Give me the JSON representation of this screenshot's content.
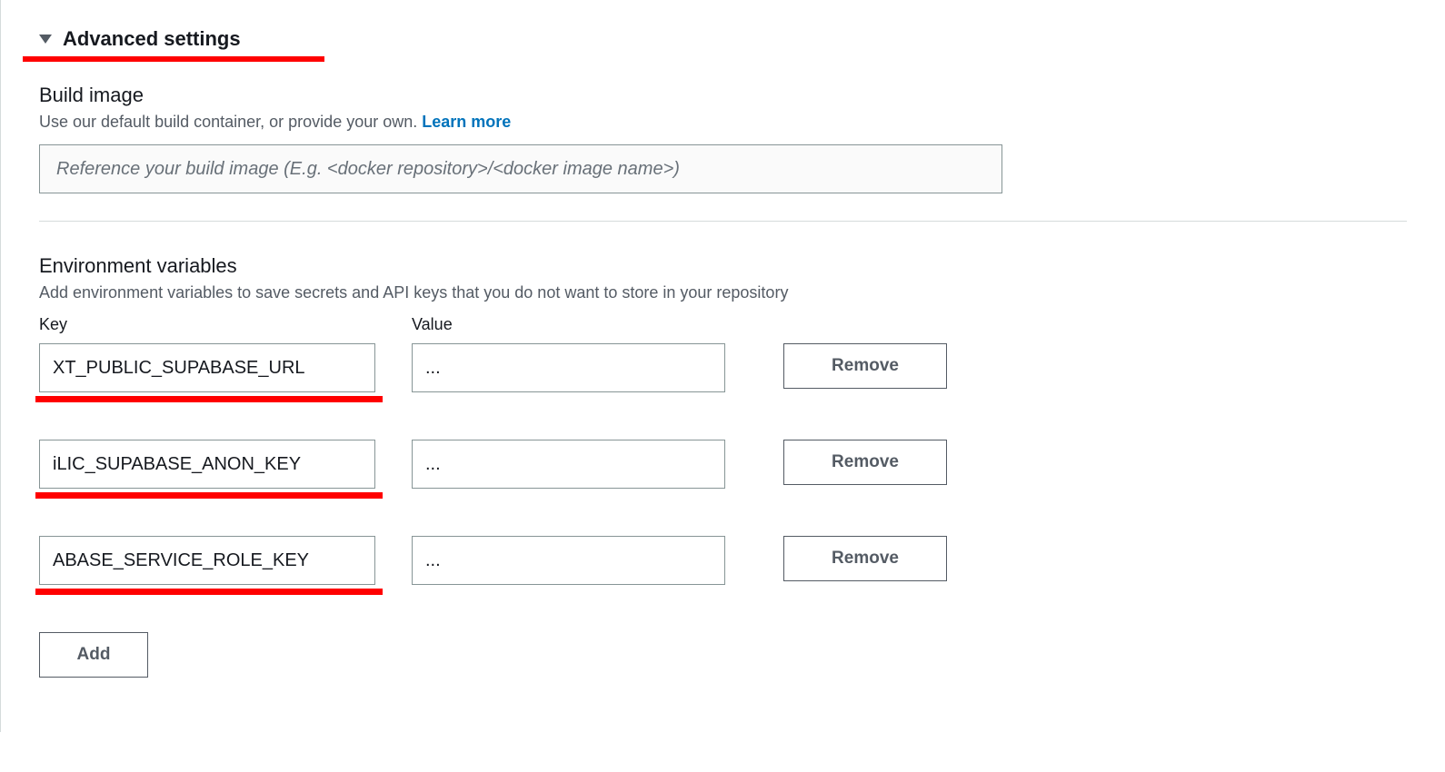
{
  "advanced": {
    "title": "Advanced settings"
  },
  "buildImage": {
    "title": "Build image",
    "description": "Use our default build container, or provide your own. ",
    "learnMore": "Learn more",
    "placeholder": "Reference your build image (E.g. <docker repository>/<docker image name>)",
    "value": ""
  },
  "envVars": {
    "title": "Environment variables",
    "description": "Add environment variables to save secrets and API keys that you do not want to store in your repository",
    "keyHeader": "Key",
    "valueHeader": "Value",
    "removeLabel": "Remove",
    "addLabel": "Add",
    "rows": [
      {
        "key": "NEXT_PUBLIC_SUPABASE_URL",
        "displayKey": "XT_PUBLIC_SUPABASE_URL",
        "value": "..."
      },
      {
        "key": "NEXT_PUBLIC_SUPABASE_ANON_KEY",
        "displayKey": "iLIC_SUPABASE_ANON_KEY",
        "value": "..."
      },
      {
        "key": "SUPABASE_SERVICE_ROLE_KEY",
        "displayKey": "ABASE_SERVICE_ROLE_KEY",
        "value": "..."
      }
    ]
  }
}
